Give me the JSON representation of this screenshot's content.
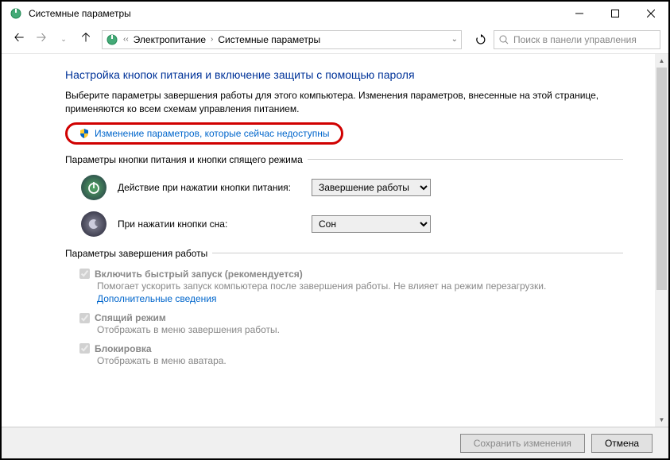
{
  "titlebar": {
    "title": "Системные параметры"
  },
  "breadcrumb": {
    "item1": "Электропитание",
    "item2": "Системные параметры"
  },
  "search": {
    "placeholder": "Поиск в панели управления"
  },
  "heading": "Настройка кнопок питания и включение защиты с помощью пароля",
  "description": "Выберите параметры завершения работы для этого компьютера. Изменения параметров, внесенные на этой странице, применяются ко всем схемам управления питанием.",
  "change_link": "Изменение параметров, которые сейчас недоступны",
  "section1": {
    "header": "Параметры кнопки питания и кнопки спящего режима",
    "row1": {
      "label": "Действие при нажатии кнопки питания:",
      "value": "Завершение работы"
    },
    "row2": {
      "label": "При нажатии кнопки сна:",
      "value": "Сон"
    }
  },
  "section2": {
    "header": "Параметры завершения работы",
    "chk1": {
      "label": "Включить быстрый запуск (рекомендуется)",
      "sub": "Помогает ускорить запуск компьютера после завершения работы. Не влияет на режим перезагрузки.",
      "link": "Дополнительные сведения"
    },
    "chk2": {
      "label": "Спящий режим",
      "sub": "Отображать в меню завершения работы."
    },
    "chk3": {
      "label": "Блокировка",
      "sub": "Отображать в меню аватара."
    }
  },
  "footer": {
    "save": "Сохранить изменения",
    "cancel": "Отмена"
  }
}
